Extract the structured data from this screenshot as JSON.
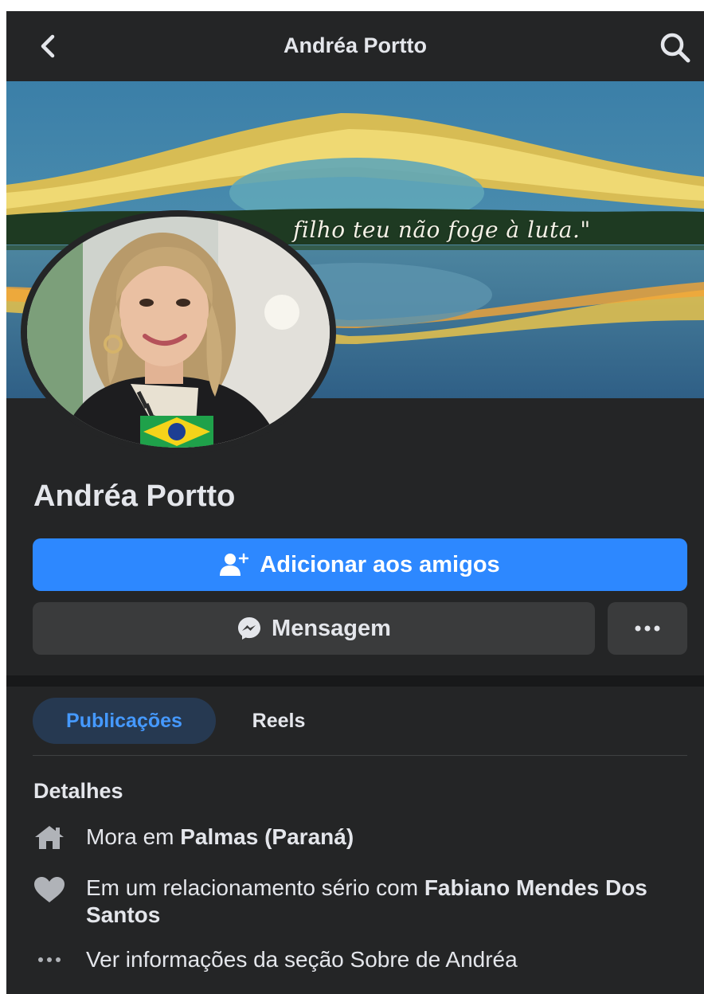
{
  "header": {
    "title": "Andréa Portto"
  },
  "cover": {
    "quote": "filho teu não foge à luta.\""
  },
  "profile": {
    "name": "Andréa Portto"
  },
  "actions": {
    "add_friend_label": "Adicionar aos amigos",
    "message_label": "Mensagem"
  },
  "tabs": [
    {
      "label": "Publicações",
      "selected": true
    },
    {
      "label": "Reels",
      "selected": false
    }
  ],
  "details": {
    "title": "Detalhes",
    "lives_prefix": "Mora em",
    "lives_place": "Palmas (Paraná)",
    "relationship_prefix": "Em um relacionamento sério com",
    "relationship_person": "Fabiano Mendes Dos Santos",
    "see_about": "Ver informações da seção Sobre de Andréa"
  },
  "icons": {
    "back": "chevron-left-icon",
    "search": "search-icon",
    "add_friend": "person-plus-icon",
    "messenger": "messenger-icon",
    "more": "more-horizontal-icon",
    "home": "home-icon",
    "heart": "heart-icon",
    "dots": "dots-icon"
  },
  "colors": {
    "background": "#242526",
    "primary_button": "#2d88ff",
    "secondary_button": "#3a3b3c",
    "selected_tab_bg": "#263951",
    "selected_tab_text": "#4599ff",
    "text": "#e4e6eb"
  }
}
